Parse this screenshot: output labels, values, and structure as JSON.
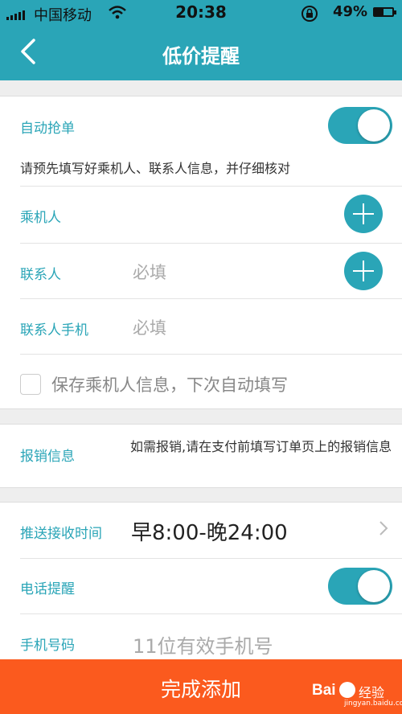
{
  "status_bar": {
    "carrier": "中国移动",
    "time": "20:38",
    "battery": "49%",
    "battery_level": 0.49
  },
  "nav": {
    "title": "低价提醒"
  },
  "auto_grab": {
    "label": "自动抢单",
    "enabled": true,
    "hint": "请预先填写好乘机人、联系人信息，并仔细核对"
  },
  "passenger": {
    "label": "乘机人"
  },
  "contact": {
    "label": "联系人",
    "placeholder": "必填"
  },
  "contact_phone": {
    "label": "联系人手机",
    "placeholder": "必填"
  },
  "save_info": {
    "label": "保存乘机人信息，下次自动填写",
    "checked": false
  },
  "reimbursement": {
    "label": "报销信息",
    "text": "如需报销,请在支付前填写订单页上的报销信息"
  },
  "push_time": {
    "label": "推送接收时间",
    "value": "早8:00-晚24:00"
  },
  "phone_reminder": {
    "label": "电话提醒",
    "enabled": true
  },
  "mobile": {
    "label": "手机号码",
    "placeholder": "11位有效手机号"
  },
  "footer": {
    "submit_label": "完成添加"
  },
  "watermark": {
    "brand": "Bai",
    "brand_suffix": "经验",
    "site": "jingyan.baidu.com"
  },
  "colors": {
    "accent": "#2aa5b7",
    "submit": "#fb5a1e",
    "background": "#eeeeee"
  }
}
